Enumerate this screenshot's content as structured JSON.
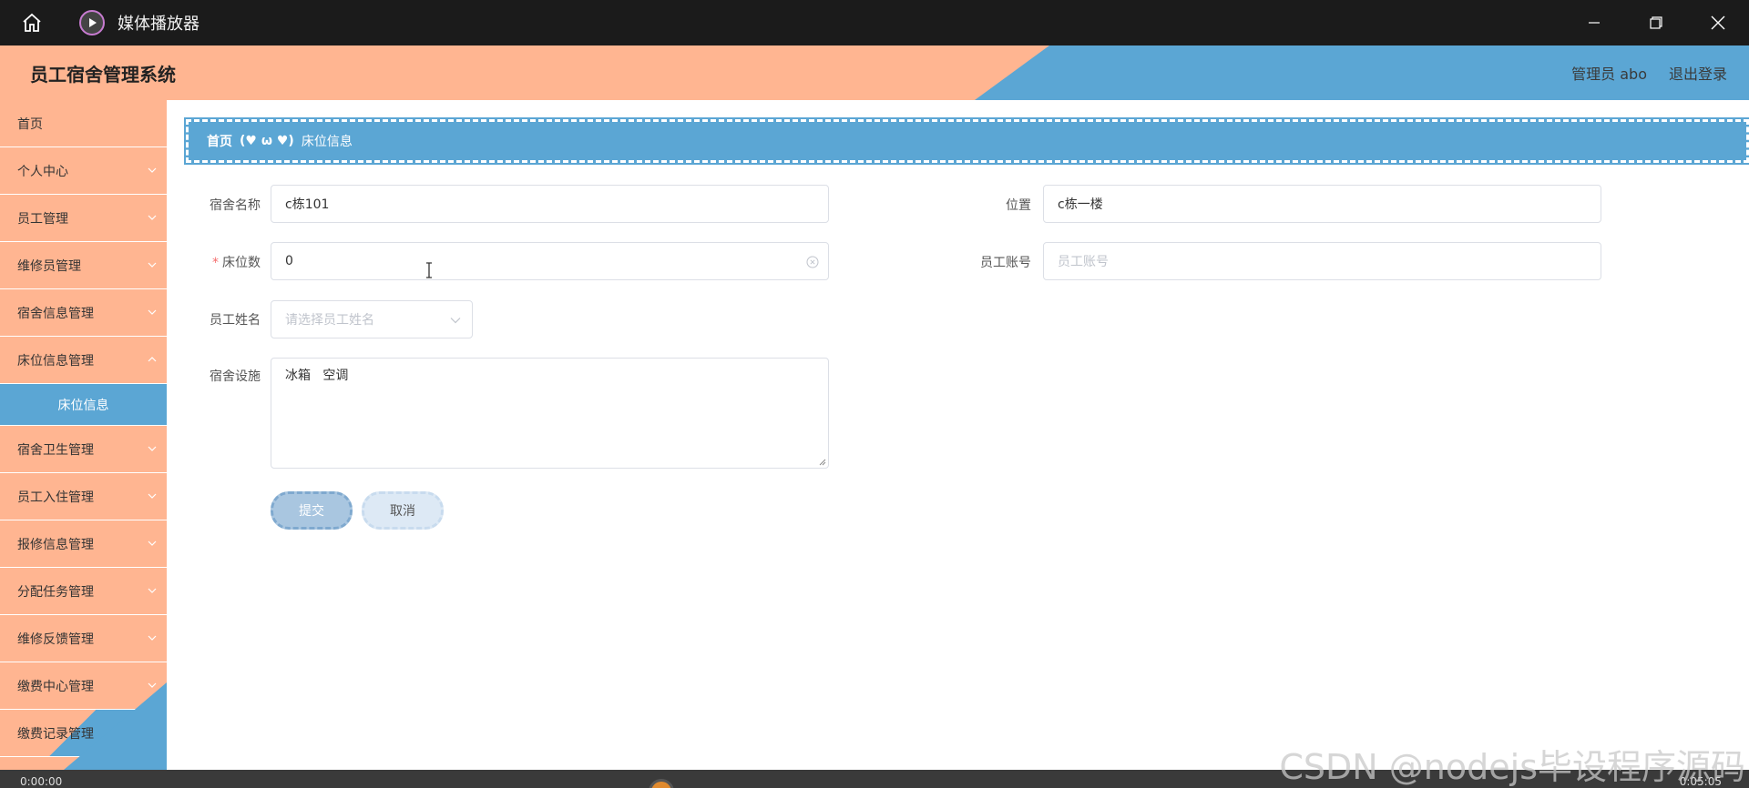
{
  "window": {
    "title": "媒体播放器"
  },
  "header": {
    "app_title": "员工宿舍管理系统",
    "user_label": "管理员 abo",
    "logout_label": "退出登录"
  },
  "sidebar": {
    "items": [
      {
        "label": "首页"
      },
      {
        "label": "个人中心"
      },
      {
        "label": "员工管理"
      },
      {
        "label": "维修员管理"
      },
      {
        "label": "宿舍信息管理"
      },
      {
        "label": "床位信息管理"
      },
      {
        "label": "宿舍卫生管理"
      },
      {
        "label": "员工入住管理"
      },
      {
        "label": "报修信息管理"
      },
      {
        "label": "分配任务管理"
      },
      {
        "label": "维修反馈管理"
      },
      {
        "label": "缴费中心管理"
      },
      {
        "label": "缴费记录管理"
      }
    ],
    "active_sub": "床位信息"
  },
  "breadcrumb": {
    "home": "首页",
    "separator": "(♥ ω ♥)",
    "current": "床位信息"
  },
  "form": {
    "dorm_name": {
      "label": "宿舍名称",
      "value": "c栋101"
    },
    "location": {
      "label": "位置",
      "value": "c栋一楼"
    },
    "beds": {
      "label": "床位数",
      "value": "0",
      "required_mark": "*"
    },
    "employee_account": {
      "label": "员工账号",
      "placeholder": "员工账号"
    },
    "employee_name": {
      "label": "员工姓名",
      "placeholder": "请选择员工姓名"
    },
    "facilities": {
      "label": "宿舍设施",
      "value": "冰箱   空调"
    },
    "submit_label": "提交",
    "cancel_label": "取消"
  },
  "player": {
    "time_left": "0:00:00",
    "time_right": "0:05:05"
  },
  "watermark": "CSDN @nodejs毕设程序源码",
  "colors": {
    "peach": "#ffb591",
    "blue": "#5ba6d4",
    "titlebar": "#1b1b1b"
  }
}
